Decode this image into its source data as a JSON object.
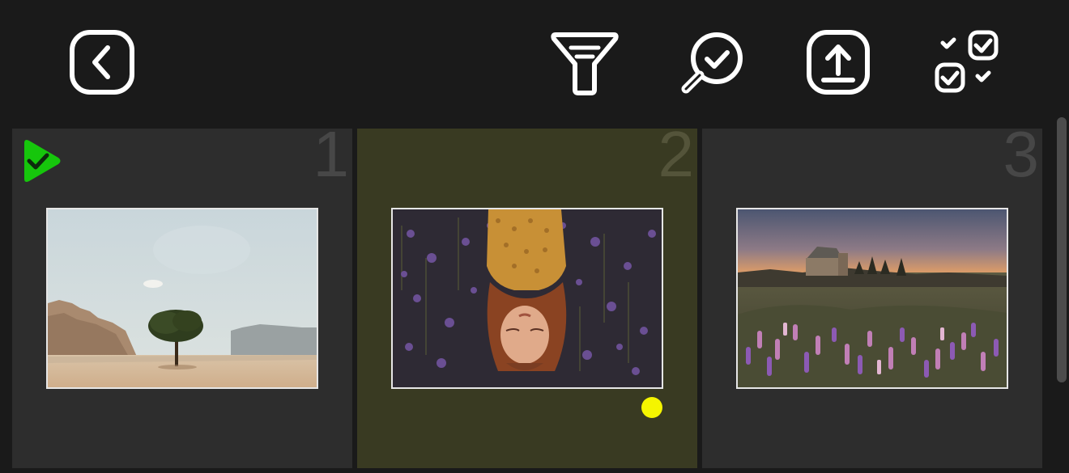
{
  "toolbar": {
    "buttons": [
      {
        "name": "back",
        "icon": "chevron-left-icon"
      },
      {
        "name": "filter",
        "icon": "funnel-icon"
      },
      {
        "name": "review",
        "icon": "magnifier-check-icon"
      },
      {
        "name": "export",
        "icon": "upload-icon"
      },
      {
        "name": "select-multiple",
        "icon": "multi-checklist-icon"
      }
    ]
  },
  "cards": [
    {
      "number": "1",
      "photo": "desert-tree",
      "flag": "accepted",
      "selected": false
    },
    {
      "number": "2",
      "photo": "woman-lavender",
      "marker": "yellow-dot",
      "selected": true
    },
    {
      "number": "3",
      "photo": "church-lupins",
      "selected": false
    }
  ],
  "colors": {
    "background": "#1a1a1a",
    "card": "#2d2d2d",
    "card_selected": "#393a22",
    "flag_green": "#16c60c",
    "marker_yellow": "#f5f500",
    "icon_stroke": "#ffffff"
  }
}
